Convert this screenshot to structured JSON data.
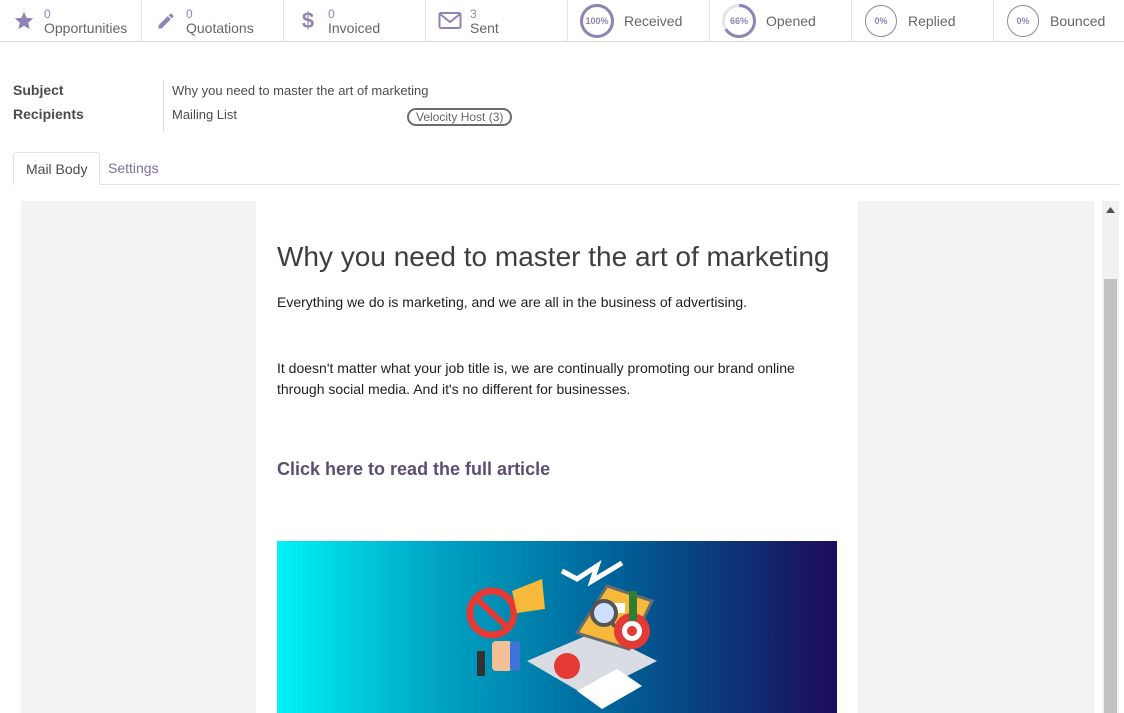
{
  "stats": [
    {
      "icon": "star-icon",
      "value": "0",
      "label": "Opportunities"
    },
    {
      "icon": "pencil-icon",
      "value": "0",
      "label": "Quotations"
    },
    {
      "icon": "dollar-icon",
      "value": "0",
      "label": "Invoiced"
    },
    {
      "icon": "envelope-icon",
      "value": "3",
      "label": "Sent"
    }
  ],
  "gauges": [
    {
      "percent_text": "100%",
      "percent": 100,
      "label": "Received"
    },
    {
      "percent_text": "66%",
      "percent": 66,
      "label": "Opened"
    },
    {
      "percent_text": "0%",
      "percent": 0,
      "label": "Replied"
    },
    {
      "percent_text": "0%",
      "percent": 0,
      "label": "Bounced"
    }
  ],
  "form": {
    "subject_label": "Subject",
    "subject_value": "Why you need to master the art of marketing",
    "recipients_label": "Recipients",
    "recipients_value": "Mailing List",
    "recipients_tag": "Velocity Host (3)"
  },
  "tabs": {
    "mail_body": "Mail Body",
    "settings": "Settings"
  },
  "mail": {
    "heading": "Why you need to master the art of marketing",
    "para1": "Everything we do is marketing, and we are all in the business of advertising.",
    "para2": "It doesn't matter what your job title is, we are continually promoting our brand online through social media. And it's no different for businesses.",
    "cta": "Click here to read the full article",
    "image_alt": "marketing illustration"
  },
  "colors": {
    "accent": "#8f84b5",
    "link": "#5c4e72",
    "gauge_track": "#e6e3ef"
  }
}
